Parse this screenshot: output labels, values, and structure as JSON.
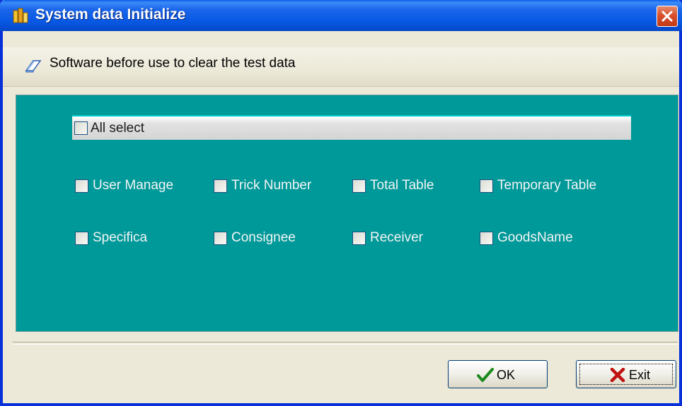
{
  "window": {
    "title": "System data Initialize",
    "title_color": "#ffffff",
    "titlebar_color": "#0858e4"
  },
  "header": {
    "text": "Software before use to clear the test data"
  },
  "panel": {
    "background": "#009999",
    "all_select": {
      "label": "All select",
      "checked": false
    },
    "options": [
      {
        "label": "User Manage",
        "checked": false
      },
      {
        "label": "Trick Number",
        "checked": false
      },
      {
        "label": "Total Table",
        "checked": false
      },
      {
        "label": "Temporary Table",
        "checked": false
      },
      {
        "label": "Specifica",
        "checked": false
      },
      {
        "label": "Consignee",
        "checked": false
      },
      {
        "label": "Receiver",
        "checked": false
      },
      {
        "label": "GoodsName",
        "checked": false
      }
    ]
  },
  "buttons": {
    "ok_label": "OK",
    "exit_label": "Exit"
  },
  "icons": {
    "app": "app-icon",
    "close": "close-icon",
    "eraser": "eraser-icon",
    "ok": "checkmark-icon",
    "exit": "x-icon"
  }
}
